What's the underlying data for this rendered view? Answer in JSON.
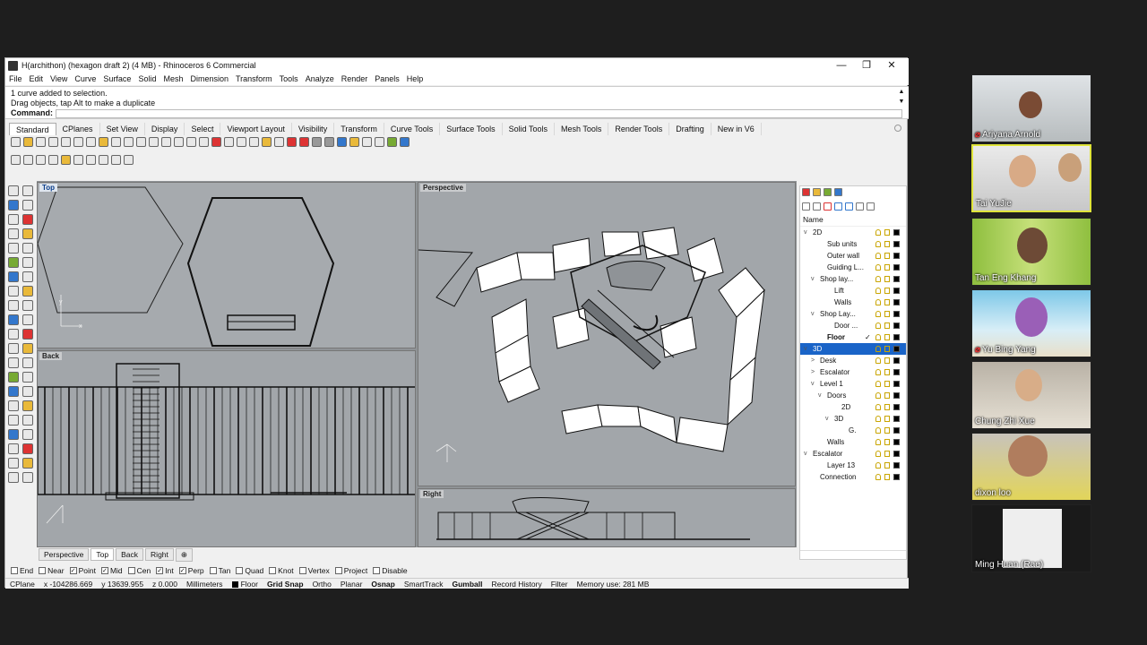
{
  "window": {
    "title": "H(archithon) (hexagon draft 2) (4 MB) - Rhinoceros 6 Commercial",
    "minimize": "—",
    "maximize": "❐",
    "close": "✕"
  },
  "menu": [
    "File",
    "Edit",
    "View",
    "Curve",
    "Surface",
    "Solid",
    "Mesh",
    "Dimension",
    "Transform",
    "Tools",
    "Analyze",
    "Render",
    "Panels",
    "Help"
  ],
  "command": {
    "history": [
      "1 curve added to selection.",
      "Drag objects, tap Alt to make a duplicate"
    ],
    "label": "Command:",
    "value": ""
  },
  "toolbar_tabs": [
    "Standard",
    "CPlanes",
    "Set View",
    "Display",
    "Select",
    "Viewport Layout",
    "Visibility",
    "Transform",
    "Curve Tools",
    "Surface Tools",
    "Solid Tools",
    "Mesh Tools",
    "Render Tools",
    "Drafting",
    "New in V6"
  ],
  "viewports": {
    "top": "Top",
    "perspective": "Perspective",
    "back": "Back",
    "right": "Right"
  },
  "viewport_tabs": [
    "Perspective",
    "Top",
    "Back",
    "Right"
  ],
  "viewport_tab_add": "⊕",
  "layers": {
    "header": "Name",
    "rows": [
      {
        "name": "2D",
        "level": 0,
        "chev": "v"
      },
      {
        "name": "Sub units",
        "level": 2,
        "chev": ""
      },
      {
        "name": "Outer wall",
        "level": 2,
        "chev": ""
      },
      {
        "name": "Guiding L...",
        "level": 2,
        "chev": ""
      },
      {
        "name": "Shop lay...",
        "level": 1,
        "chev": "v"
      },
      {
        "name": "Lift",
        "level": 3,
        "chev": ""
      },
      {
        "name": "Walls",
        "level": 3,
        "chev": ""
      },
      {
        "name": "Shop Lay...",
        "level": 1,
        "chev": "v"
      },
      {
        "name": "Door ...",
        "level": 3,
        "chev": ""
      },
      {
        "name": "Floor",
        "level": 2,
        "chev": "",
        "bold": true,
        "check": "✓"
      },
      {
        "name": "3D",
        "level": 0,
        "chev": "v",
        "selected": true
      },
      {
        "name": "Desk",
        "level": 1,
        "chev": ">"
      },
      {
        "name": "Escalator",
        "level": 1,
        "chev": ">"
      },
      {
        "name": "Level 1",
        "level": 1,
        "chev": "v"
      },
      {
        "name": "Doors",
        "level": 2,
        "chev": "v"
      },
      {
        "name": "2D",
        "level": 4,
        "chev": ""
      },
      {
        "name": "3D",
        "level": 3,
        "chev": "v"
      },
      {
        "name": "G.",
        "level": 5,
        "chev": ""
      },
      {
        "name": "Walls",
        "level": 2,
        "chev": ""
      },
      {
        "name": "Escalator",
        "level": 0,
        "chev": "v"
      },
      {
        "name": "Layer 13",
        "level": 2,
        "chev": ""
      },
      {
        "name": "Connection",
        "level": 1,
        "chev": ""
      }
    ]
  },
  "osnap": [
    {
      "label": "End",
      "checked": false
    },
    {
      "label": "Near",
      "checked": false
    },
    {
      "label": "Point",
      "checked": true
    },
    {
      "label": "Mid",
      "checked": true
    },
    {
      "label": "Cen",
      "checked": false
    },
    {
      "label": "Int",
      "checked": true
    },
    {
      "label": "Perp",
      "checked": true
    },
    {
      "label": "Tan",
      "checked": false
    },
    {
      "label": "Quad",
      "checked": false
    },
    {
      "label": "Knot",
      "checked": false
    },
    {
      "label": "Vertex",
      "checked": false
    },
    {
      "label": "Project",
      "checked": false
    },
    {
      "label": "Disable",
      "checked": false
    }
  ],
  "status": {
    "cplane": "CPlane",
    "x": "x -104286.669",
    "y": "y 13639.955",
    "z": "z 0.000",
    "units": "Millimeters",
    "layer": "Floor",
    "grid_snap": "Grid Snap",
    "ortho": "Ortho",
    "planar": "Planar",
    "osnap": "Osnap",
    "smarttrack": "SmartTrack",
    "gumball": "Gumball",
    "record_history": "Record History",
    "filter": "Filter",
    "memory": "Memory use: 281 MB"
  },
  "participants": [
    {
      "name": "Ariyana Arnold",
      "muted": true
    },
    {
      "name": "Tai YuJie",
      "muted": false,
      "active": true
    },
    {
      "name": "Tan Eng Khang",
      "muted": false
    },
    {
      "name": "Yu Bing Yang",
      "muted": true
    },
    {
      "name": "Chung Zhi Xue",
      "muted": false
    },
    {
      "name": "dixon loo",
      "muted": false
    },
    {
      "name": "Ming Huan (Rae)",
      "muted": false
    }
  ],
  "colors": {
    "accent": "#1a64c8",
    "viewport": "#a2a6aa",
    "zoom_highlight": "#dfe43a"
  }
}
